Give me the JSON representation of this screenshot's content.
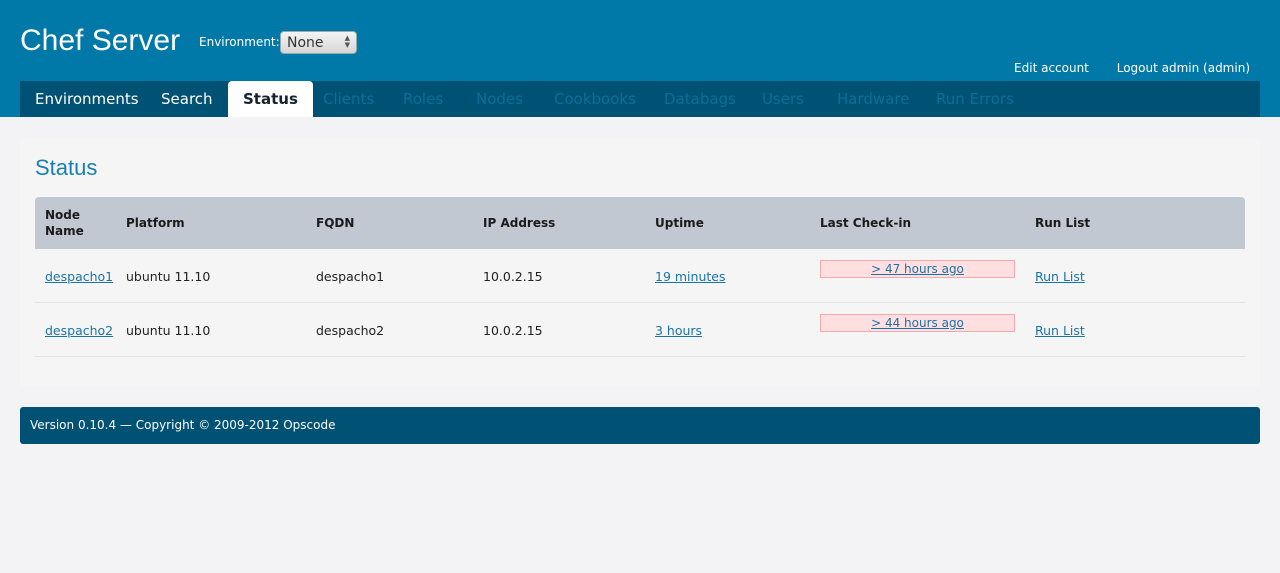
{
  "app": {
    "title": "Chef Server",
    "environment_label": "Environment:",
    "environment_value": "None"
  },
  "user_links": {
    "edit_account": "Edit account",
    "logout": "Logout admin (admin)"
  },
  "tabs": [
    {
      "label": "Environments",
      "state": "enabled"
    },
    {
      "label": "Search",
      "state": "enabled"
    },
    {
      "label": "Status",
      "state": "active"
    },
    {
      "label": "Clients",
      "state": "disabled"
    },
    {
      "label": "Roles",
      "state": "disabled"
    },
    {
      "label": "Nodes",
      "state": "disabled"
    },
    {
      "label": "Cookbooks",
      "state": "disabled"
    },
    {
      "label": "Databags",
      "state": "disabled"
    },
    {
      "label": "Users",
      "state": "disabled"
    },
    {
      "label": "Hardware",
      "state": "disabled"
    },
    {
      "label": "Run Errors",
      "state": "disabled"
    }
  ],
  "status": {
    "title": "Status",
    "columns": {
      "node_name": "Node Name",
      "platform": "Platform",
      "fqdn": "FQDN",
      "ip": "IP Address",
      "uptime": "Uptime",
      "checkin": "Last Check-in",
      "runlist": "Run List"
    },
    "rows": [
      {
        "node": "despacho1",
        "platform": "ubuntu 11.10",
        "fqdn": "despacho1",
        "ip": "10.0.2.15",
        "uptime": "19 minutes",
        "checkin": "> 47 hours ago",
        "runlist": "Run List"
      },
      {
        "node": "despacho2",
        "platform": "ubuntu 11.10",
        "fqdn": "despacho2",
        "ip": "10.0.2.15",
        "uptime": "3 hours",
        "checkin": "> 44 hours ago",
        "runlist": "Run List"
      }
    ]
  },
  "footer": {
    "text": "Version 0.10.4 — Copyright © 2009-2012 Opscode"
  },
  "colors": {
    "header_bg": "#0079a8",
    "tabbar_bg": "#005274",
    "checkin_warning_bg": "#ffdfe0",
    "link": "#1a73a8"
  }
}
